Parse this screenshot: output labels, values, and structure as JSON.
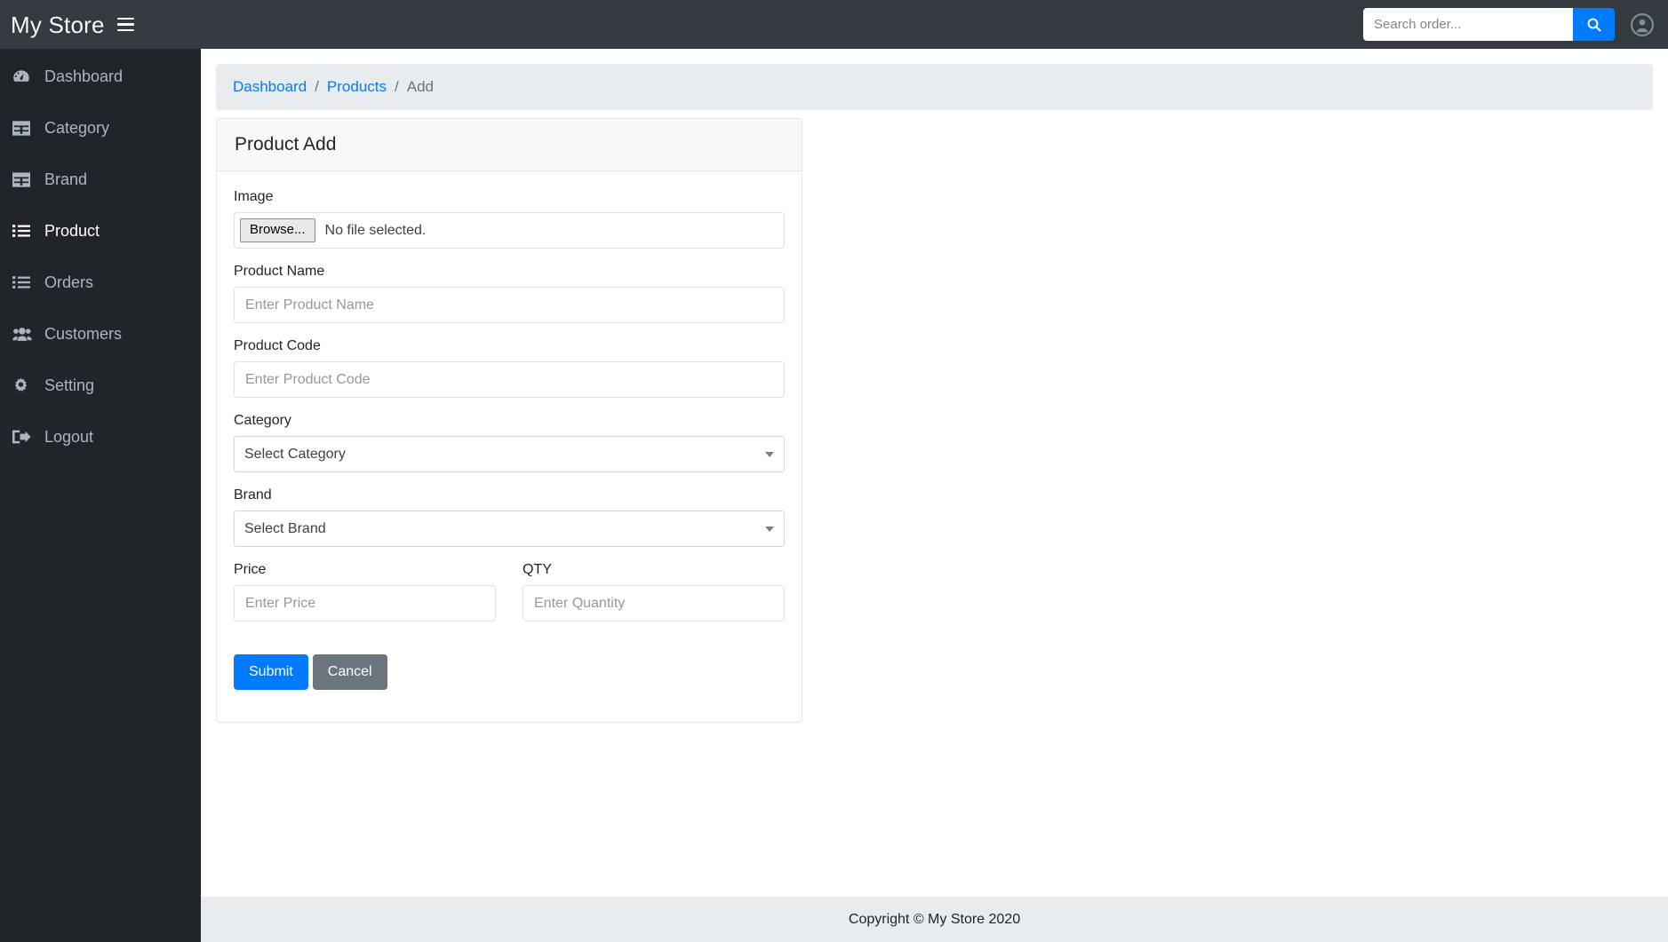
{
  "navbar": {
    "brand": "My Store",
    "menu_toggle_icon": "hamburger-icon",
    "search": {
      "placeholder": "Search order...",
      "value": "",
      "button_icon": "search-icon"
    },
    "account_icon": "user-circle-icon",
    "background_color": "#343a40",
    "accent_color": "#007bff"
  },
  "sidebar": {
    "background_color": "#212529",
    "items": [
      {
        "label": "Dashboard",
        "icon": "tachometer-icon",
        "active": false
      },
      {
        "label": "Category",
        "icon": "table-icon",
        "active": false
      },
      {
        "label": "Brand",
        "icon": "table-icon",
        "active": false
      },
      {
        "label": "Product",
        "icon": "list-ul-icon",
        "active": true
      },
      {
        "label": "Orders",
        "icon": "list-ul-icon",
        "active": false
      },
      {
        "label": "Customers",
        "icon": "users-icon",
        "active": false
      },
      {
        "label": "Setting",
        "icon": "gear-icon",
        "active": false
      },
      {
        "label": "Logout",
        "icon": "sign-out-icon",
        "active": false
      }
    ]
  },
  "breadcrumb": {
    "items": [
      {
        "label": "Dashboard",
        "link": true
      },
      {
        "label": "Products",
        "link": true
      },
      {
        "label": "Add",
        "link": false
      }
    ],
    "separator": "/",
    "link_color": "#007bff",
    "background_color": "#e9ecef"
  },
  "card": {
    "title": "Product Add",
    "fields": {
      "image": {
        "label": "Image",
        "browse_label": "Browse...",
        "file_status": "No file selected."
      },
      "product_name": {
        "label": "Product Name",
        "placeholder": "Enter Product Name",
        "value": ""
      },
      "product_code": {
        "label": "Product Code",
        "placeholder": "Enter Product Code",
        "value": ""
      },
      "category": {
        "label": "Category",
        "selected": "Select Category",
        "options": [
          "Select Category"
        ]
      },
      "brand": {
        "label": "Brand",
        "selected": "Select Brand",
        "options": [
          "Select Brand"
        ]
      },
      "price": {
        "label": "Price",
        "placeholder": "Enter Price",
        "value": ""
      },
      "qty": {
        "label": "QTY",
        "placeholder": "Enter Quantity",
        "value": ""
      }
    },
    "buttons": {
      "submit": "Submit",
      "cancel": "Cancel",
      "submit_color": "#007bff",
      "cancel_color": "#6c757d"
    }
  },
  "footer": {
    "text": "Copyright © My Store 2020",
    "background_color": "#e9ecef"
  }
}
